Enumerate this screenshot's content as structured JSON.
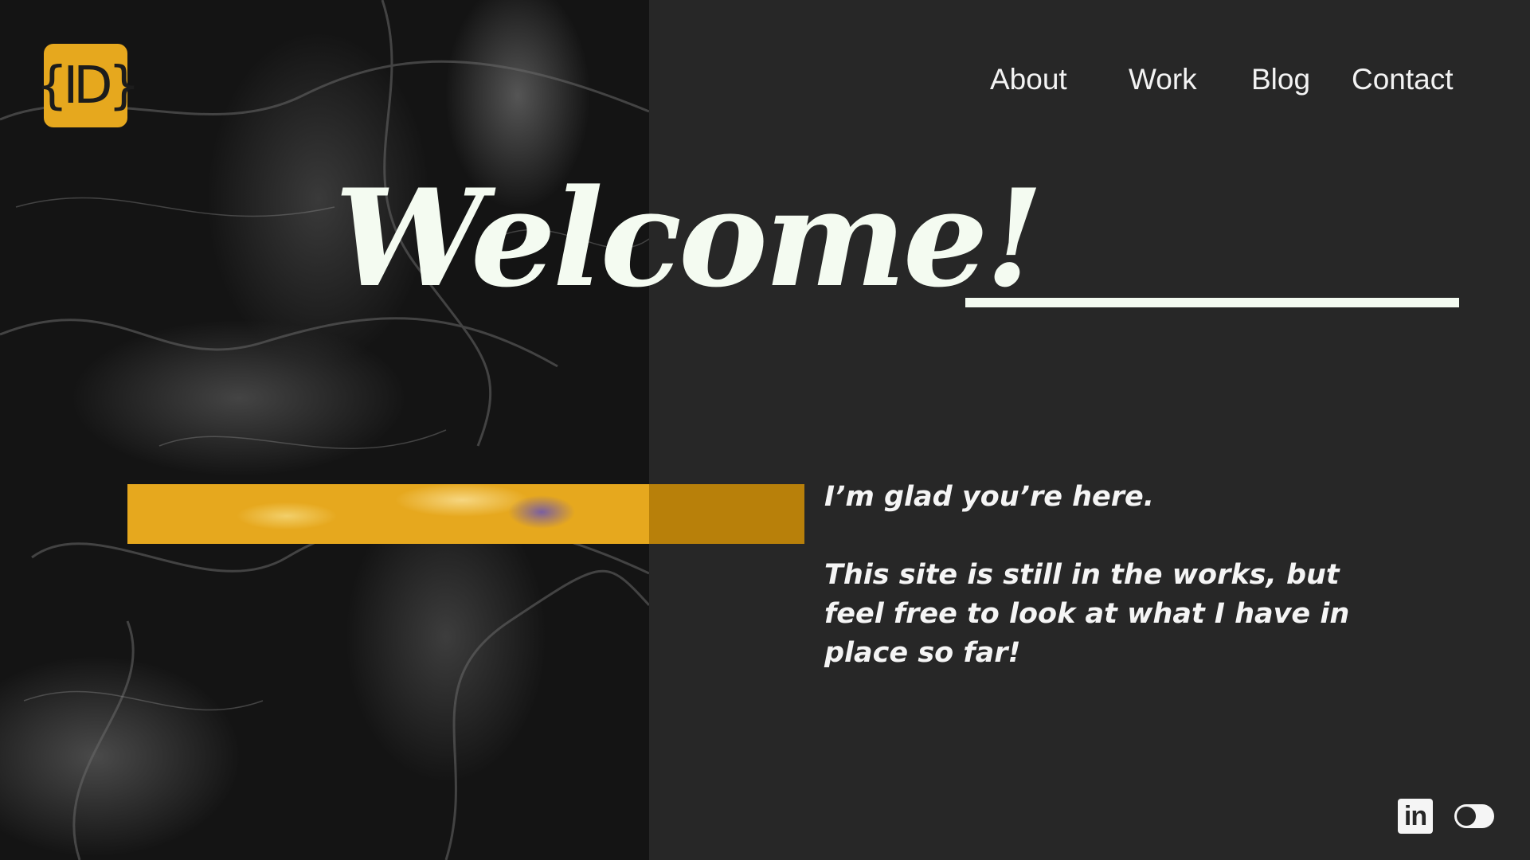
{
  "logo": {
    "text": "{ID}",
    "icon": "id-logo-icon"
  },
  "nav": {
    "items": [
      {
        "label": "About"
      },
      {
        "label": "Work"
      },
      {
        "label": "Blog"
      },
      {
        "label": "Contact"
      }
    ]
  },
  "hero": {
    "title": "Welcome!"
  },
  "message": {
    "line1": "I’m glad you’re here.",
    "line2": "This site is still in the works, but feel free to look at what I have in place so far!"
  },
  "footer": {
    "linkedin_text": "in",
    "linkedin_icon": "linkedin-icon",
    "toggle_icon": "theme-toggle"
  },
  "colors": {
    "background": "#272727",
    "accent": "#e6a81e",
    "accent_dark": "#b8800a",
    "text": "#f4fbf1"
  }
}
